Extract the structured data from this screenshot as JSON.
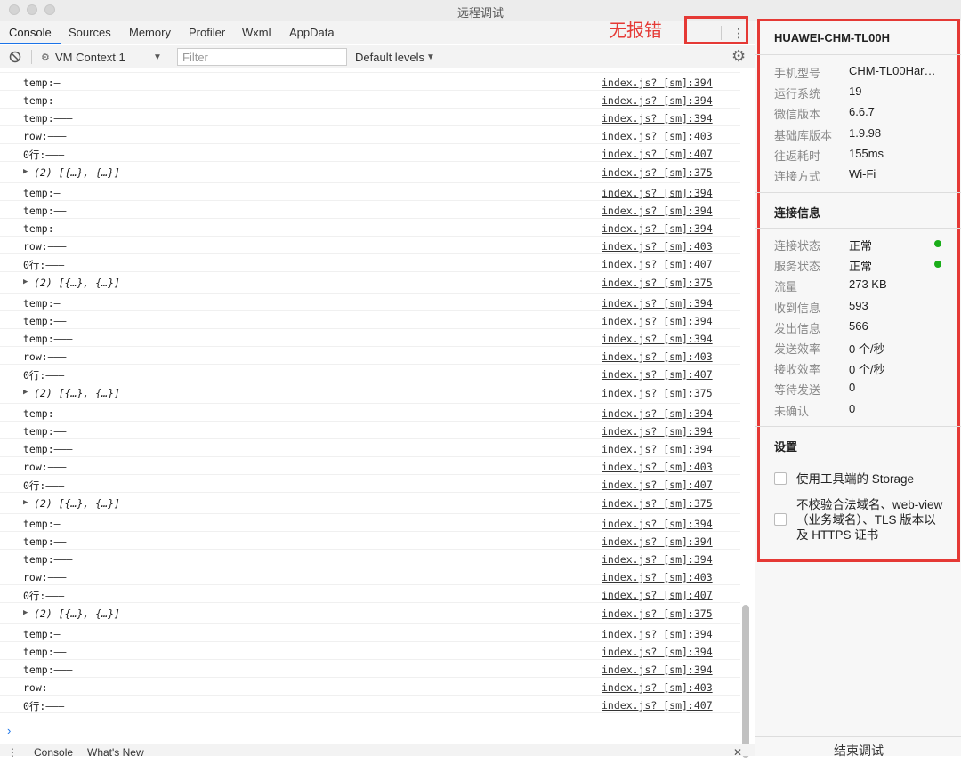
{
  "window": {
    "title": "远程调试"
  },
  "tabs": [
    "Console",
    "Sources",
    "Memory",
    "Profiler",
    "Wxml",
    "AppData"
  ],
  "annotation": "无报错",
  "toolbar": {
    "context": "VM Context 1",
    "filter_placeholder": "Filter",
    "levels": "Default levels"
  },
  "logs": [
    {
      "type": "text",
      "msg": "temp:–",
      "src": "index.js? [sm]:394"
    },
    {
      "type": "text",
      "msg": "temp:——",
      "src": "index.js? [sm]:394"
    },
    {
      "type": "text",
      "msg": "temp:———",
      "src": "index.js? [sm]:394"
    },
    {
      "type": "text",
      "msg": "row:———",
      "src": "index.js? [sm]:403"
    },
    {
      "type": "text",
      "msg": "0行:———",
      "src": "index.js? [sm]:407"
    },
    {
      "type": "array",
      "msg": "(2) [{…}, {…}]",
      "src": "index.js? [sm]:375"
    },
    {
      "type": "text",
      "msg": "temp:–",
      "src": "index.js? [sm]:394"
    },
    {
      "type": "text",
      "msg": "temp:——",
      "src": "index.js? [sm]:394"
    },
    {
      "type": "text",
      "msg": "temp:———",
      "src": "index.js? [sm]:394"
    },
    {
      "type": "text",
      "msg": "row:———",
      "src": "index.js? [sm]:403"
    },
    {
      "type": "text",
      "msg": "0行:———",
      "src": "index.js? [sm]:407"
    },
    {
      "type": "array",
      "msg": "(2) [{…}, {…}]",
      "src": "index.js? [sm]:375"
    },
    {
      "type": "text",
      "msg": "temp:–",
      "src": "index.js? [sm]:394"
    },
    {
      "type": "text",
      "msg": "temp:——",
      "src": "index.js? [sm]:394"
    },
    {
      "type": "text",
      "msg": "temp:———",
      "src": "index.js? [sm]:394"
    },
    {
      "type": "text",
      "msg": "row:———",
      "src": "index.js? [sm]:403"
    },
    {
      "type": "text",
      "msg": "0行:———",
      "src": "index.js? [sm]:407"
    },
    {
      "type": "array",
      "msg": "(2) [{…}, {…}]",
      "src": "index.js? [sm]:375"
    },
    {
      "type": "text",
      "msg": "temp:–",
      "src": "index.js? [sm]:394"
    },
    {
      "type": "text",
      "msg": "temp:——",
      "src": "index.js? [sm]:394"
    },
    {
      "type": "text",
      "msg": "temp:———",
      "src": "index.js? [sm]:394"
    },
    {
      "type": "text",
      "msg": "row:———",
      "src": "index.js? [sm]:403"
    },
    {
      "type": "text",
      "msg": "0行:———",
      "src": "index.js? [sm]:407"
    },
    {
      "type": "array",
      "msg": "(2) [{…}, {…}]",
      "src": "index.js? [sm]:375"
    },
    {
      "type": "text",
      "msg": "temp:–",
      "src": "index.js? [sm]:394"
    },
    {
      "type": "text",
      "msg": "temp:——",
      "src": "index.js? [sm]:394"
    },
    {
      "type": "text",
      "msg": "temp:———",
      "src": "index.js? [sm]:394"
    },
    {
      "type": "text",
      "msg": "row:———",
      "src": "index.js? [sm]:403"
    },
    {
      "type": "text",
      "msg": "0行:———",
      "src": "index.js? [sm]:407"
    },
    {
      "type": "array",
      "msg": "(2) [{…}, {…}]",
      "src": "index.js? [sm]:375"
    },
    {
      "type": "text",
      "msg": "temp:–",
      "src": "index.js? [sm]:394"
    },
    {
      "type": "text",
      "msg": "temp:——",
      "src": "index.js? [sm]:394"
    },
    {
      "type": "text",
      "msg": "temp:———",
      "src": "index.js? [sm]:394"
    },
    {
      "type": "text",
      "msg": "row:———",
      "src": "index.js? [sm]:403"
    },
    {
      "type": "text",
      "msg": "0行:———",
      "src": "index.js? [sm]:407"
    }
  ],
  "drawer_tabs": [
    "Console",
    "What's New"
  ],
  "device": {
    "name": "HUAWEI-CHM-TL00H",
    "info": [
      {
        "label": "手机型号",
        "value": "CHM-TL00Har…"
      },
      {
        "label": "运行系统",
        "value": "19"
      },
      {
        "label": "微信版本",
        "value": "6.6.7"
      },
      {
        "label": "基础库版本",
        "value": "1.9.98"
      },
      {
        "label": "往返耗时",
        "value": "155ms"
      },
      {
        "label": "连接方式",
        "value": "Wi-Fi"
      }
    ]
  },
  "connection": {
    "title": "连接信息",
    "rows": [
      {
        "label": "连接状态",
        "value": "正常",
        "dot": true
      },
      {
        "label": "服务状态",
        "value": "正常",
        "dot": true
      },
      {
        "label": "流量",
        "value": "273 KB"
      },
      {
        "label": "收到信息",
        "value": "593"
      },
      {
        "label": "发出信息",
        "value": "566"
      },
      {
        "label": "发送效率",
        "value": "0 个/秒"
      },
      {
        "label": "接收效率",
        "value": "0 个/秒"
      },
      {
        "label": "等待发送",
        "value": "0"
      },
      {
        "label": "未确认",
        "value": "0"
      }
    ]
  },
  "settings": {
    "title": "设置",
    "options": [
      {
        "label": "使用工具端的 Storage"
      },
      {
        "label": "不校验合法域名、web-view（业务域名）、TLS 版本以及 HTTPS 证书"
      }
    ]
  },
  "end_button": "结束调试",
  "colors": {
    "annotation": "#e53935",
    "status_ok": "#1aad19",
    "active_tab": "#1a73e8"
  }
}
